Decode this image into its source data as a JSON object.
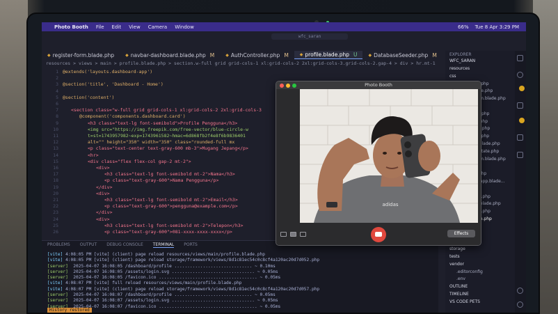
{
  "menubar": {
    "app_name": "Photo Booth",
    "items": [
      "File",
      "Edit",
      "View",
      "Camera",
      "Window"
    ],
    "battery": "66%",
    "datetime": "Tue 8 Apr  3:29 PM"
  },
  "editor": {
    "search_placeholder": "wfc_saran",
    "tabs": [
      {
        "label": "register-form.blade.php",
        "status": ""
      },
      {
        "label": "navbar-dashboard.blade.php",
        "status": "M"
      },
      {
        "label": "AuthController.php",
        "status": "M"
      },
      {
        "label": "profile.blade.php",
        "status": "U",
        "active": true
      },
      {
        "label": "DatabaseSeeder.php",
        "status": "M"
      }
    ],
    "breadcrumb": "resources > views > main > profile.blade.php > section.w-full grid grid-cols-1 xl:grid-cols-2 2xl:grid-cols-3.grid-cols-2.gap-4 > div > hr.mt-1",
    "code_lines": [
      {
        "n": "1",
        "t": "@extends('layouts.dashboard-app')",
        "c": "at",
        "i": 0
      },
      {
        "n": "2",
        "t": "",
        "c": "tx",
        "i": 0
      },
      {
        "n": "3",
        "t": "@section('title', 'Dashboard - Home')",
        "c": "at",
        "i": 0
      },
      {
        "n": "4",
        "t": "",
        "c": "tx",
        "i": 0
      },
      {
        "n": "5",
        "t": "@section('content')",
        "c": "at",
        "i": 0
      },
      {
        "n": "6",
        "t": "",
        "c": "tx",
        "i": 0
      },
      {
        "n": "7",
        "t": "<section class=\"w-full grid grid-cols-1 xl:grid-cols-2 2xl:grid-cols-3",
        "c": "tg",
        "i": 1
      },
      {
        "n": "8",
        "t": "@component('components.dashboard.card')",
        "c": "at",
        "i": 2
      },
      {
        "n": "9",
        "t": "<h3 class=\"text-lg font-semibold\">Profile Pengguna</h3>",
        "c": "tg",
        "i": 3
      },
      {
        "n": "10",
        "t": "<img src=\"https://img.freepik.com/free-vector/blue-circle-w",
        "c": "st",
        "i": 3
      },
      {
        "n": "11",
        "t": "t=st=1743957982~exp=1743961582~hmac=6d868fb2f4e8f6b9836401",
        "c": "st",
        "i": 3
      },
      {
        "n": "12",
        "t": "alt=\"\" height=\"350\" width=\"350\" class=\"rounded-full mx",
        "c": "at",
        "i": 3
      },
      {
        "n": "13",
        "t": "<p class=\"text-center text-gray-600 mb-3\">Mugang Jepang</p>",
        "c": "tg",
        "i": 3
      },
      {
        "n": "14",
        "t": "<hr>",
        "c": "tg",
        "i": 3
      },
      {
        "n": "15",
        "t": "<div class=\"flex flex-col gap-2 mt-2\">",
        "c": "tg",
        "i": 3
      },
      {
        "n": "16",
        "t": "<div>",
        "c": "tg",
        "i": 4
      },
      {
        "n": "17",
        "t": "<h3 class=\"text-lg font-semibold mt-2\">Nama</h3>",
        "c": "tg",
        "i": 5
      },
      {
        "n": "18",
        "t": "<p class=\"text-gray-600\">Nama Pengguna</p>",
        "c": "tg",
        "i": 5
      },
      {
        "n": "19",
        "t": "</div>",
        "c": "tg",
        "i": 4
      },
      {
        "n": "20",
        "t": "<div>",
        "c": "tg",
        "i": 4
      },
      {
        "n": "21",
        "t": "<h3 class=\"text-lg font-semibold mt-2\">Email</h3>",
        "c": "tg",
        "i": 5
      },
      {
        "n": "22",
        "t": "<p class=\"text-gray-600\">pengguna@example.com</p>",
        "c": "tg",
        "i": 5
      },
      {
        "n": "23",
        "t": "</div>",
        "c": "tg",
        "i": 4
      },
      {
        "n": "24",
        "t": "<div>",
        "c": "tg",
        "i": 4
      },
      {
        "n": "25",
        "t": "<h3 class=\"text-lg font-semibold mt-2\">Telepon</h3>",
        "c": "tg",
        "i": 5
      },
      {
        "n": "26",
        "t": "<p class=\"text-gray-600\">081-xxxx-xxxx-xxxx</p>",
        "c": "tg",
        "i": 5
      }
    ]
  },
  "panel": {
    "tabs": [
      "PROBLEMS",
      "OUTPUT",
      "DEBUG CONSOLE",
      "TERMINAL",
      "PORTS"
    ],
    "active_tab": "TERMINAL",
    "terminal_lines": [
      {
        "p": "[vite]",
        "c": "vite",
        "t": " 4:08:05 PM [vite] (client) page reload resources/views/main/profile.blade.php"
      },
      {
        "p": "[vite]",
        "c": "vite",
        "t": " 4:08:05 PM [vite] (client) page reload storage/framework/views/8d1c81ec54c0c8cf4a120ac20d7d052.php"
      },
      {
        "p": "[server]",
        "c": "srv",
        "t": "  2025-04-07 16:08:05 /dashboard/profile .............................. ~ 0.10ms"
      },
      {
        "p": "[server]",
        "c": "srv",
        "t": "  2025-04-07 16:08:05 /assets/login.svg ................................ ~ 0.05ms"
      },
      {
        "p": "[server]",
        "c": "srv",
        "t": "  2025-04-07 16:08:05 /favicon.ico ...................................... ~ 0.05ms"
      },
      {
        "p": "[vite]",
        "c": "vite",
        "t": " 4:08:07 PM [vite] full reload resources/views/main/profile.blade.php"
      },
      {
        "p": "[vite]",
        "c": "vite",
        "t": " 4:08:07 PM [vite] (client) page reload storage/framework/views/8d1c81ec54c0c8cf4a120ac20d7d057.php"
      },
      {
        "p": "[server]",
        "c": "srv",
        "t": "  2025-04-07 16:08:07 /dashboard/profile .............................. ~ 0.05ms"
      },
      {
        "p": "[server]",
        "c": "srv",
        "t": "  2025-04-07 16:08:07 /assets/login.svg ................................ ~ 0.05ms"
      },
      {
        "p": "[server]",
        "c": "srv",
        "t": "  2025-04-07 16:08:07 /favicon.ico ...................................... ~ 0.05ms"
      }
    ],
    "history": "History restored"
  },
  "sidebar": {
    "header": "EXPLORER",
    "project": "WFC_SARAN",
    "items": [
      {
        "label": "resources",
        "kind": "fld"
      },
      {
        "label": "css",
        "kind": "fld"
      },
      {
        "label": "login.blade.php",
        "kind": "file"
      },
      {
        "label": "navbar.blade.php",
        "kind": "file"
      },
      {
        "label": "register-form.blade.php",
        "kind": "file"
      },
      {
        "label": "components",
        "kind": "fld"
      },
      {
        "label": "chart.blade.php",
        "kind": "file"
      },
      {
        "label": "card.blade.php",
        "kind": "file"
      },
      {
        "label": "chats.blade.php",
        "kind": "file"
      },
      {
        "label": "table.blade.php",
        "kind": "file"
      },
      {
        "label": "login-form.blade.php",
        "kind": "file"
      },
      {
        "label": "login-form.state.php",
        "kind": "file"
      },
      {
        "label": "register-form.blade.php",
        "kind": "file"
      },
      {
        "label": "layouts",
        "kind": "fld"
      },
      {
        "label": "app.blade.php",
        "kind": "file"
      },
      {
        "label": "dashboard-app.blade...",
        "kind": "file"
      },
      {
        "label": "main",
        "kind": "fld"
      },
      {
        "label": "home.blade.php",
        "kind": "file"
      },
      {
        "label": "dashboard.blade.php",
        "kind": "file"
      },
      {
        "label": "home.blade.php",
        "kind": "file"
      },
      {
        "label": "profile.blade.php",
        "kind": "sel"
      },
      {
        "label": "routes",
        "kind": "fld"
      },
      {
        "label": "console.php",
        "kind": "file"
      },
      {
        "label": "web.php",
        "kind": "file"
      },
      {
        "label": "storage",
        "kind": "fld"
      },
      {
        "label": "tests",
        "kind": "fld"
      },
      {
        "label": "vendor",
        "kind": "fld"
      },
      {
        "label": ".editorconfig",
        "kind": "file"
      },
      {
        "label": ".env",
        "kind": "file"
      },
      {
        "label": "OUTLINE",
        "kind": "fld"
      },
      {
        "label": "TIMELINE",
        "kind": "fld"
      },
      {
        "label": "VS CODE PETS",
        "kind": "fld"
      }
    ]
  },
  "photobooth": {
    "title": "Photo Booth",
    "effects_label": "Effects",
    "traffic_colors": [
      "#ff5f57",
      "#febc2e",
      "#28c840"
    ],
    "shutter_color": "#e0483e"
  }
}
